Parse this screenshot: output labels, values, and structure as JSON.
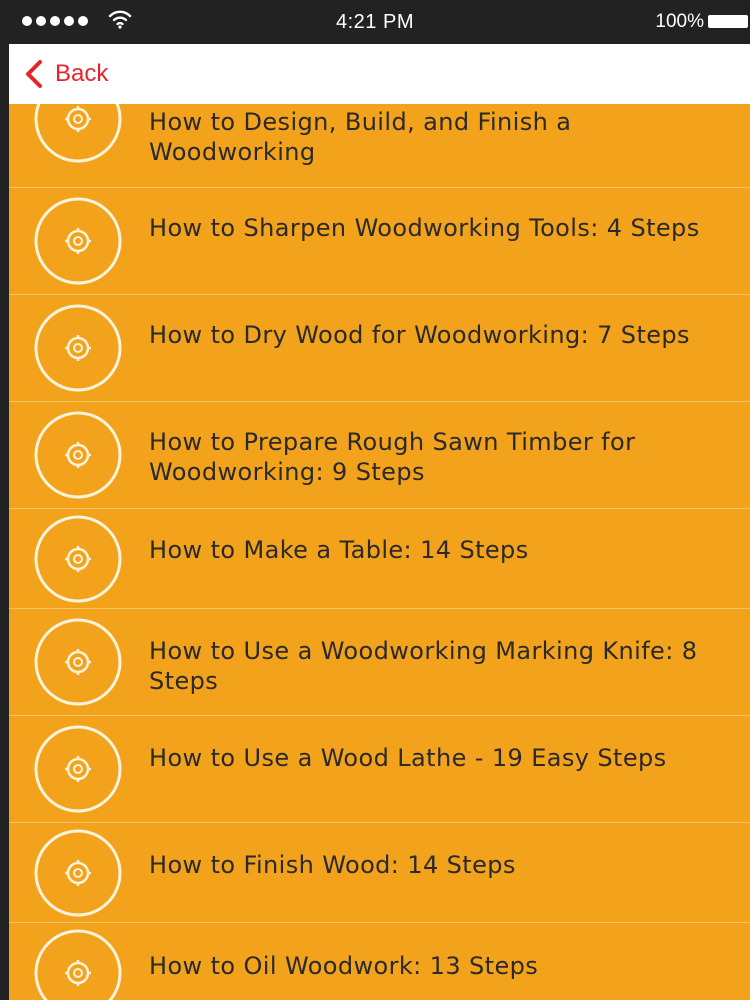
{
  "status_bar": {
    "time": "4:21 PM",
    "battery_percent": "100%"
  },
  "nav": {
    "back_label": "Back"
  },
  "list": {
    "items": [
      {
        "title": "How to Design, Build, and Finish a Woodworking"
      },
      {
        "title": "How to Sharpen Woodworking Tools: 4 Steps"
      },
      {
        "title": "How to Dry Wood for Woodworking: 7 Steps"
      },
      {
        "title": "How to Prepare Rough Sawn Timber for Woodworking: 9 Steps"
      },
      {
        "title": "How to Make a Table: 14 Steps"
      },
      {
        "title": "How to Use a Woodworking Marking Knife: 8 Steps"
      },
      {
        "title": "How to Use a Wood Lathe - 19 Easy Steps"
      },
      {
        "title": "How to Finish Wood: 14 Steps"
      },
      {
        "title": "How to Oil Woodwork: 13 Steps"
      }
    ]
  },
  "colors": {
    "accent": "#e8242b",
    "list_background": "#f3a21b",
    "text": "#2a2a2a"
  },
  "icons": {
    "list_item_icon": "target-icon",
    "back_icon": "chevron-left-icon"
  }
}
